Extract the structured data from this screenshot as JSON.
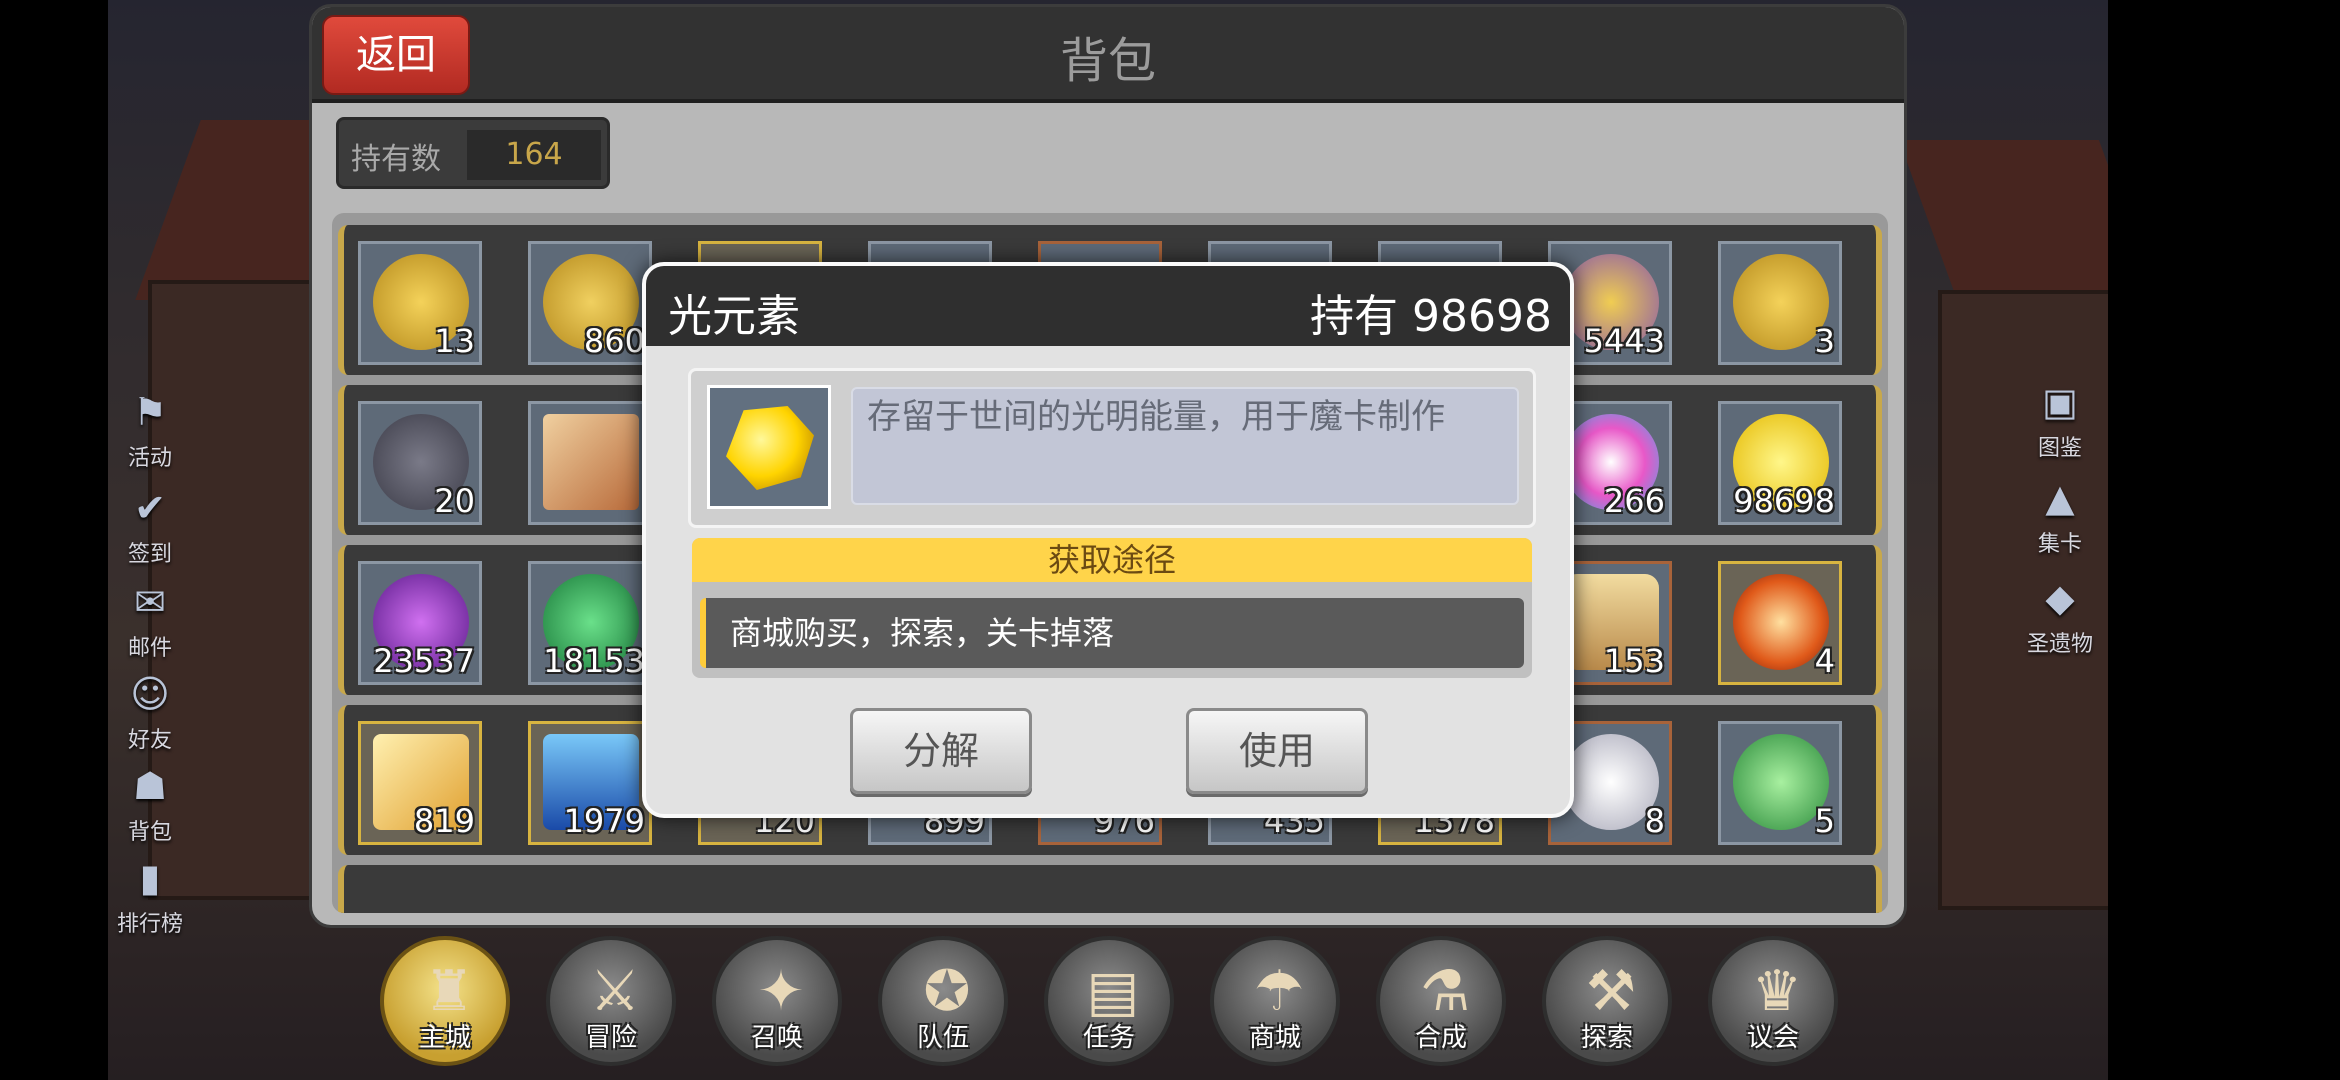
{
  "header": {
    "title": "背包",
    "back_label": "返回"
  },
  "count": {
    "label": "持有数",
    "value": "164"
  },
  "left_menu": [
    {
      "label": "活动",
      "icon": "activity-icon"
    },
    {
      "label": "签到",
      "icon": "checkin-icon"
    },
    {
      "label": "邮件",
      "icon": "mail-icon"
    },
    {
      "label": "好友",
      "icon": "friends-icon"
    },
    {
      "label": "背包",
      "icon": "backpack-icon"
    },
    {
      "label": "排行榜",
      "icon": "ranking-icon"
    }
  ],
  "right_menu": [
    {
      "label": "图鉴",
      "icon": "codex-icon"
    },
    {
      "label": "集卡",
      "icon": "card-collection-icon"
    },
    {
      "label": "圣遗物",
      "icon": "relic-icon"
    }
  ],
  "grid": {
    "row1": [
      "13",
      "860",
      "",
      "",
      "",
      "",
      "",
      "5443",
      "3"
    ],
    "row2": [
      "20",
      "",
      "",
      "",
      "",
      "",
      "",
      "266",
      "98698"
    ],
    "row3": [
      "23537",
      "18153",
      "",
      "",
      "",
      "",
      "",
      "153",
      "4"
    ],
    "row4": [
      "819",
      "1979",
      "120",
      "899",
      "976",
      "435",
      "1378",
      "8",
      "5"
    ]
  },
  "popup": {
    "name": "光元素",
    "own": "持有 98698",
    "description": "存留于世间的光明能量，用于魔卡制作",
    "source_title": "获取途径",
    "source_text": "商城购买，探索，关卡掉落",
    "decompose_label": "分解",
    "use_label": "使用"
  },
  "bottom_nav": [
    {
      "label": "主城",
      "icon": "castle-icon"
    },
    {
      "label": "冒险",
      "icon": "adventure-icon"
    },
    {
      "label": "召唤",
      "icon": "summon-icon"
    },
    {
      "label": "队伍",
      "icon": "team-icon"
    },
    {
      "label": "任务",
      "icon": "quest-icon"
    },
    {
      "label": "商城",
      "icon": "shop-icon"
    },
    {
      "label": "合成",
      "icon": "craft-icon"
    },
    {
      "label": "探索",
      "icon": "explore-icon"
    },
    {
      "label": "议会",
      "icon": "council-icon"
    }
  ]
}
